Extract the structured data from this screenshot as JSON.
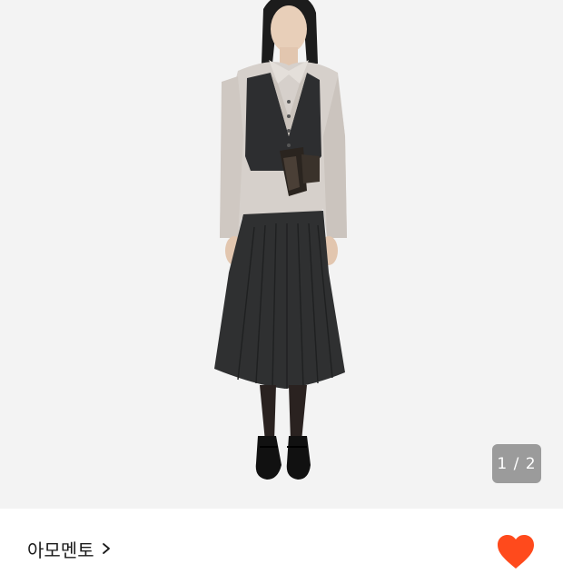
{
  "product_image": {
    "alt_name": "product-photo",
    "counter_text": "1 / 2"
  },
  "brand": {
    "name": "아모멘토",
    "chevron_icon": "chevron-right-icon"
  },
  "wishlist": {
    "icon": "heart-icon",
    "color": "#ff4a1c"
  }
}
